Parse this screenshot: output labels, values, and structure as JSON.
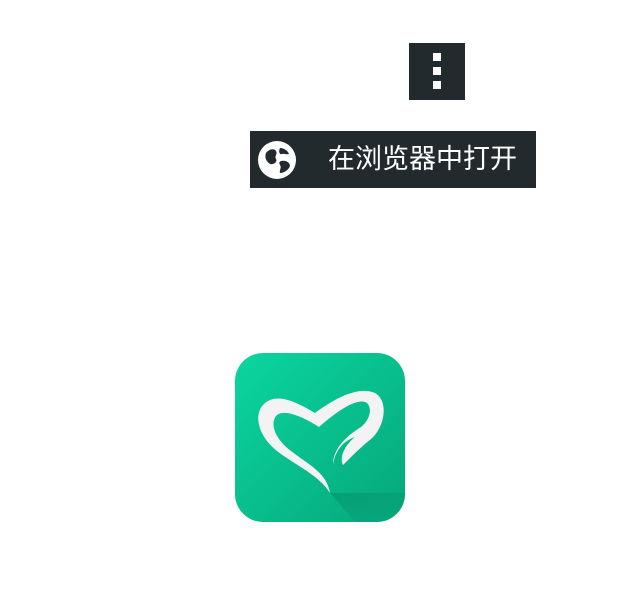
{
  "menu": {
    "icon": "more-vert-icon"
  },
  "open_in_browser": {
    "icon": "globe-icon",
    "label": "在浏览器中打开"
  },
  "app_logo": {
    "icon": "heart-leaf-logo",
    "colors": {
      "gradient_start": "#0ad6a0",
      "gradient_end": "#06a77a",
      "shape": "#f3f3f3"
    }
  }
}
